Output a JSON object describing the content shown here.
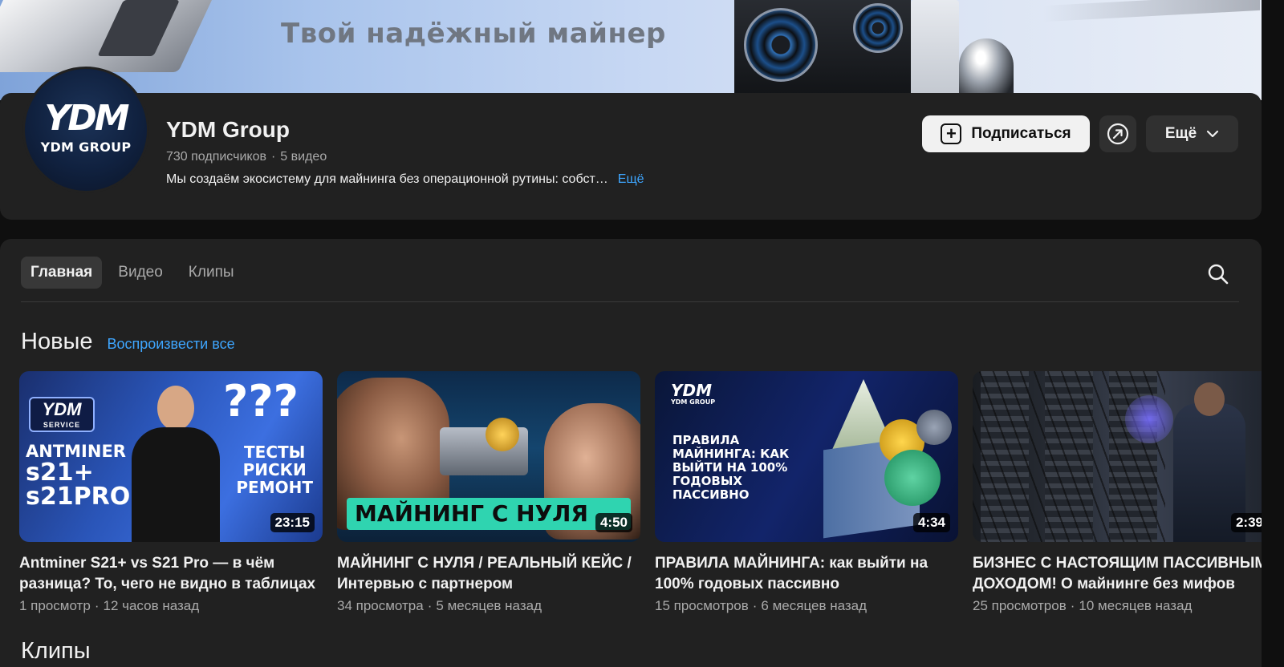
{
  "banner": {
    "slogan": "Твой надёжный майнер"
  },
  "channel": {
    "avatar_mark": "YDM",
    "avatar_text": "YDM GROUP",
    "name": "YDM Group",
    "subscribers": "730 подписчиков",
    "videos_count": "5 видео",
    "meta_separator": "·",
    "description": "Мы создаём экосистему для майнинга без операционной рутины: собст…",
    "description_more": "Ещё",
    "subscribe_label": "Подписаться",
    "more_label": "Ещё"
  },
  "tabs": [
    {
      "label": "Главная",
      "active": true
    },
    {
      "label": "Видео",
      "active": false
    },
    {
      "label": "Клипы",
      "active": false
    }
  ],
  "section": {
    "title": "Новые",
    "play_all": "Воспроизвести все"
  },
  "videos": [
    {
      "title": "Antminer S21+ vs S21 Pro — в чём разница? То, чего не видно в таблицах",
      "title_line1": "Antminer S21+ vs S21 Pro — в чём",
      "title_line2": "разница? То, чего не видно в таблицах",
      "views": "1 просмотр",
      "age": "12 часов назад",
      "duration": "23:15",
      "thumb_text": {
        "badge": "YDM",
        "badge_sub": "SERVICE",
        "line1": "ANTMINER",
        "line2a": "s21+",
        "line2b": "s21PRO",
        "q": "???",
        "right1": "ТЕСТЫ",
        "right2": "РИСКИ",
        "right3": "РЕМОНТ"
      }
    },
    {
      "title_line1": "МАЙНИНГ С НУЛЯ / РЕАЛЬНЫЙ КЕЙС /",
      "title_line2": "Интервью с партнером",
      "views": "34 просмотра",
      "age": "5 месяцев назад",
      "duration": "4:50",
      "thumb_text": {
        "banner": "МАЙНИНГ С НУЛЯ"
      }
    },
    {
      "title_line1": "ПРАВИЛА МАЙНИНГА: как выйти на",
      "title_line2": "100% годовых пассивно",
      "views": "15 просмотров",
      "age": "6 месяцев назад",
      "duration": "4:34",
      "thumb_text": {
        "logo": "YDM",
        "logo_sub": "YDM GROUP",
        "l1": "ПРАВИЛА",
        "l2": "МАЙНИНГА: КАК",
        "l3": "ВЫЙТИ НА 100%",
        "l4": "ГОДОВЫХ",
        "l5": "ПАССИВНО"
      }
    },
    {
      "title_line1": "БИЗНЕС С НАСТОЯЩИМ ПАССИВНЫМ",
      "title_line2": "ДОХОДОМ! О майнинге без мифов",
      "views": "25 просмотров",
      "age": "10 месяцев назад",
      "duration": "2:39"
    }
  ],
  "clips_title": "Клипы",
  "icons": {
    "subscribe": "plus-square-icon",
    "share": "share-arrow-icon",
    "more": "chevron-down-icon",
    "search": "search-icon"
  },
  "colors": {
    "background": "#0f0f0f",
    "card": "#212121",
    "accent_link": "#3ea6ff",
    "subscribe_bg": "#f1f1f1"
  }
}
